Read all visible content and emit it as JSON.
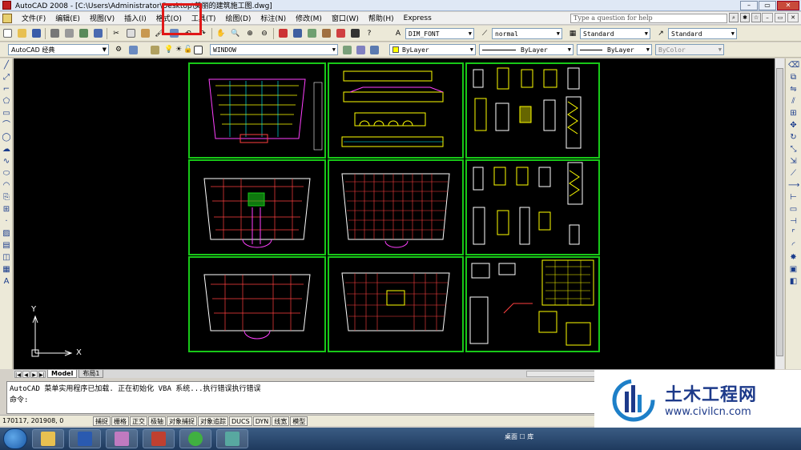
{
  "window": {
    "title": "AutoCAD 2008 - [C:\\Users\\Administrator\\Desktop\\美丽的建筑施工图.dwg]",
    "buttons": [
      "–",
      "▭",
      "✕"
    ]
  },
  "menubar": {
    "items": [
      "文件(F)",
      "编辑(E)",
      "视图(V)",
      "插入(I)",
      "格式(O)",
      "工具(T)",
      "绘图(D)",
      "标注(N)",
      "修改(M)",
      "窗口(W)",
      "帮助(H)",
      "Express"
    ],
    "help_placeholder": "Type a question for help",
    "highlighted_item": "工具(T)"
  },
  "toolbar1": {
    "dim_style": "DIM_FONT",
    "text_style": "normal",
    "table_style": "Standard",
    "multileader_style": "Standard"
  },
  "toolbar2": {
    "workspace": "AutoCAD 经典",
    "layer": "WINDOW",
    "color": "ByLayer",
    "linetype": "ByLayer",
    "lineweight": "ByLayer",
    "plotstyle": "ByColor"
  },
  "ucs": {
    "x_label": "X",
    "y_label": "Y"
  },
  "tabs": [
    "Model",
    "布局1"
  ],
  "command": {
    "line1": "AutoCAD 菜单实用程序已加载. 正在初始化 VBA 系统...执行错误执行错误",
    "line2": "命令:"
  },
  "status": {
    "coords": "170117, 201908, 0",
    "toggles": [
      "捕捉",
      "栅格",
      "正交",
      "极轴",
      "对象捕捉",
      "对象追踪",
      "DUCS",
      "DYN",
      "线宽",
      "模型"
    ]
  },
  "logo": {
    "name": "土木工程网",
    "url": "www.civilcn.com"
  },
  "taskbar": {
    "tray_text": "桌面 ☐ 库"
  },
  "colors": {
    "sheet_border": "#18c818",
    "highlight": "#e01818",
    "canvas": "#000000"
  }
}
